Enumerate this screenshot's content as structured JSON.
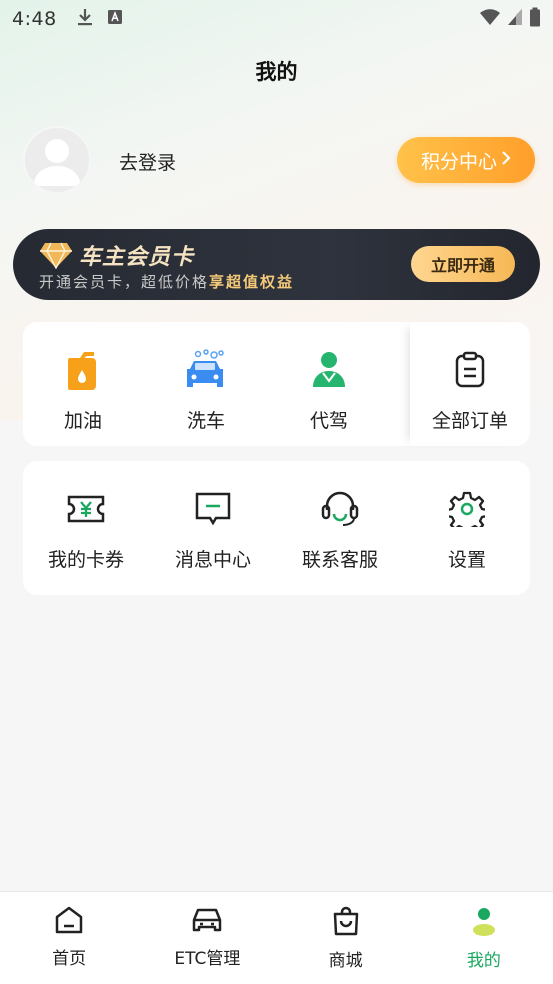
{
  "status_bar": {
    "time": "4:48"
  },
  "page": {
    "title": "我的"
  },
  "profile": {
    "login_text": "去登录",
    "points_button": "积分中心"
  },
  "vip": {
    "title": "车主会员卡",
    "subtitle_plain": "开通会员卡，超低价格",
    "subtitle_highlight": "享超值权益",
    "button": "立即开通"
  },
  "services": [
    {
      "label": "加油",
      "icon": "fuel-can-icon"
    },
    {
      "label": "洗车",
      "icon": "car-wash-icon"
    },
    {
      "label": "代驾",
      "icon": "chauffeur-icon"
    },
    {
      "label": "全部订单",
      "icon": "clipboard-icon"
    }
  ],
  "tools": [
    {
      "label": "我的卡券",
      "icon": "coupon-icon"
    },
    {
      "label": "消息中心",
      "icon": "message-icon"
    },
    {
      "label": "联系客服",
      "icon": "headset-icon"
    },
    {
      "label": "设置",
      "icon": "gear-icon"
    }
  ],
  "tabbar": [
    {
      "label": "首页",
      "icon": "home-icon",
      "active": false
    },
    {
      "label": "ETC管理",
      "icon": "car-icon",
      "active": false
    },
    {
      "label": "商城",
      "icon": "shopping-bag-icon",
      "active": false
    },
    {
      "label": "我的",
      "icon": "profile-icon",
      "active": true
    }
  ],
  "colors": {
    "accent_green": "#1aa860",
    "points_orange": "#ffa630",
    "vip_gold": "#f4c978",
    "vip_dark": "#2a2e37"
  }
}
